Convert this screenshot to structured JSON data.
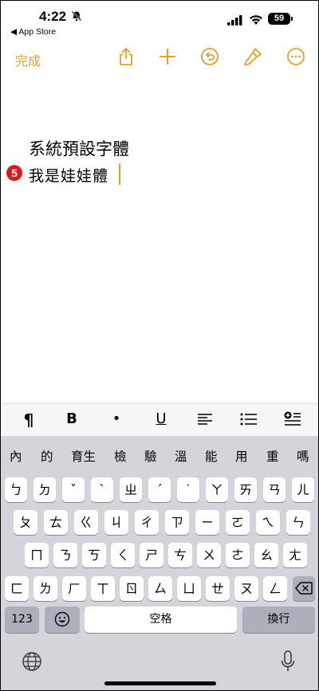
{
  "status": {
    "time": "4:22",
    "back_label": "◀ App Store",
    "battery": "59"
  },
  "toolbar": {
    "done_label": "完成",
    "icons": [
      "share-icon",
      "add-icon",
      "undo-icon",
      "markup-icon",
      "more-icon"
    ],
    "accent_color": "#e0a12c"
  },
  "note": {
    "line1": "系統預設字體",
    "line2": "我是娃娃體",
    "step_badge": "5"
  },
  "format_bar": {
    "paragraph": "¶",
    "bold": "B",
    "bullet": "•",
    "underline": "U"
  },
  "candidates": [
    "內",
    "的",
    "育生",
    "檢",
    "驗",
    "溫",
    "能",
    "用",
    "重",
    "嗎"
  ],
  "keyboard": {
    "row1": [
      "ㄅ",
      "ㄉ",
      "ˇ",
      "ˋ",
      "ㄓ",
      "ˊ",
      "˙",
      "ㄚ",
      "ㄞ",
      "ㄢ",
      "ㄦ"
    ],
    "row2": [
      "ㄆ",
      "ㄊ",
      "ㄍ",
      "ㄐ",
      "ㄔ",
      "ㄗ",
      "ㄧ",
      "ㄛ",
      "ㄟ",
      "ㄣ"
    ],
    "row3": [
      "ㄇ",
      "ㄋ",
      "ㄎ",
      "ㄑ",
      "ㄕ",
      "ㄘ",
      "ㄨ",
      "ㄜ",
      "ㄠ",
      "ㄤ"
    ],
    "row4": [
      "ㄈ",
      "ㄌ",
      "ㄏ",
      "ㄒ",
      "ㄖ",
      "ㄙ",
      "ㄩ",
      "ㄝ",
      "ㄡ",
      "ㄥ"
    ],
    "numbers_label": "123",
    "space_label": "空格",
    "return_label": "換行"
  }
}
